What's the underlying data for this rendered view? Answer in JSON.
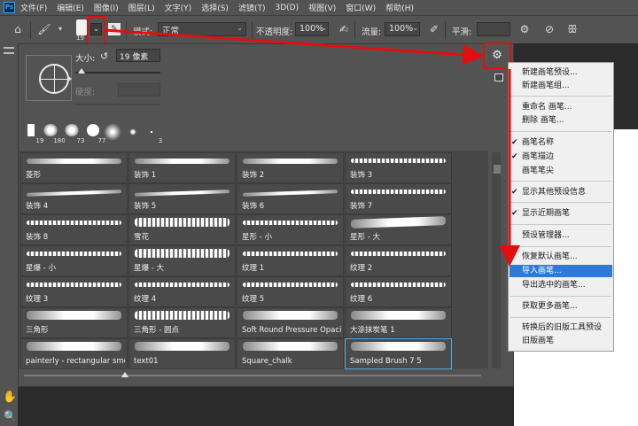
{
  "menubar": {
    "logo": "Ps",
    "items": [
      "文件(F)",
      "编辑(E)",
      "图像(I)",
      "图层(L)",
      "文字(Y)",
      "选择(S)",
      "滤镜(T)",
      "3D(D)",
      "视图(V)",
      "窗口(W)",
      "帮助(H)"
    ]
  },
  "options": {
    "brush_size_small": "19",
    "mode_label": "模式:",
    "mode_value": "正常",
    "opacity_label": "不透明度:",
    "opacity_value": "100%",
    "flow_label": "流量:",
    "flow_value": "100%",
    "smoothing_label": "平滑:"
  },
  "panel": {
    "size_label": "大小:",
    "size_value": "19 像素",
    "hardness_label": "硬度:",
    "recent": [
      "19",
      "180",
      "73",
      "77",
      "",
      "",
      "3"
    ],
    "brushes": [
      "菱形",
      "装饰 1",
      "装饰 2",
      "装饰 3",
      "装饰 4",
      "装饰 5",
      "装饰 6",
      "装饰 7",
      "装饰 8",
      "雪花",
      "星形 - 小",
      "星形 - 大",
      "星爆 - 小",
      "星爆 - 大",
      "纹理 1",
      "纹理 2",
      "纹理 3",
      "纹理 4",
      "纹理 5",
      "纹理 6",
      "三角形",
      "三角形 - 圆点",
      "Soft Round Pressure Opacity",
      "大涂抹炭笔 1",
      "painterly - rectangular smo...",
      "text01",
      "Square_chalk",
      "Sampled Brush 7 5"
    ]
  },
  "context_menu": {
    "items": [
      {
        "label": "新建画笔预设...",
        "checked": false
      },
      {
        "label": "新建画笔组...",
        "checked": false
      },
      {
        "label": "重命名 画笔...",
        "checked": false
      },
      {
        "label": "删除 画笔...",
        "checked": false
      },
      {
        "label": "画笔名称",
        "checked": true
      },
      {
        "label": "画笔描边",
        "checked": true
      },
      {
        "label": "画笔笔尖",
        "checked": false
      },
      {
        "label": "显示其他预设信息",
        "checked": true
      },
      {
        "label": "显示近期画笔",
        "checked": true
      },
      {
        "label": "预设管理器...",
        "checked": false
      },
      {
        "label": "恢复默认画笔...",
        "checked": false
      },
      {
        "label": "导入画笔...",
        "checked": false
      },
      {
        "label": "导出选中的画笔...",
        "checked": false
      },
      {
        "label": "获取更多画笔...",
        "checked": false
      },
      {
        "label": "转换后的旧版工具预设",
        "checked": false
      },
      {
        "label": "旧版画笔",
        "checked": false
      }
    ],
    "highlighted": "导入画笔..."
  },
  "colors": {
    "annotation_red": "#e01010",
    "highlight_blue": "#2e7bd6"
  }
}
